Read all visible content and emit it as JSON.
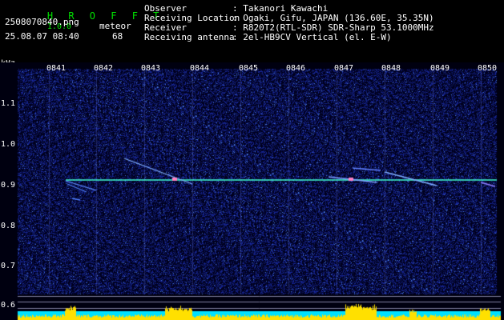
{
  "app": {
    "name": "H R O F F T",
    "version": "1.0.0"
  },
  "file": {
    "name": "2508070840.png",
    "date": "25.08.07 08:40"
  },
  "meteor": {
    "label": "meteor",
    "count": "68"
  },
  "info": [
    {
      "key": "Observer",
      "value": ": Takanori Kawachi"
    },
    {
      "key": "Receiving Location",
      "value": ": Ogaki, Gifu, JAPAN (136.60E, 35.35N)"
    },
    {
      "key": "Receiver",
      "value": ": R820T2(RTL-SDR) SDR-Sharp 53.1000MHz"
    },
    {
      "key": "Receiving antenna",
      "value": ": 2el-HB9CV Vertical (el. E-W)"
    }
  ],
  "axis": {
    "unit": "kHz",
    "x_ticks": [
      "0841",
      "0842",
      "0843",
      "0844",
      "0845",
      "0846",
      "0847",
      "0848",
      "0849",
      "0850"
    ],
    "y_ticks": [
      "1.1",
      "1.0",
      "0.9",
      "0.8",
      "0.7",
      "0.6"
    ]
  },
  "colors": {
    "background": "#000010",
    "noise": "#1a2a9a",
    "carrier": "#40ffd0",
    "level": "#ffe000",
    "baseline": "#00e0ff"
  }
}
